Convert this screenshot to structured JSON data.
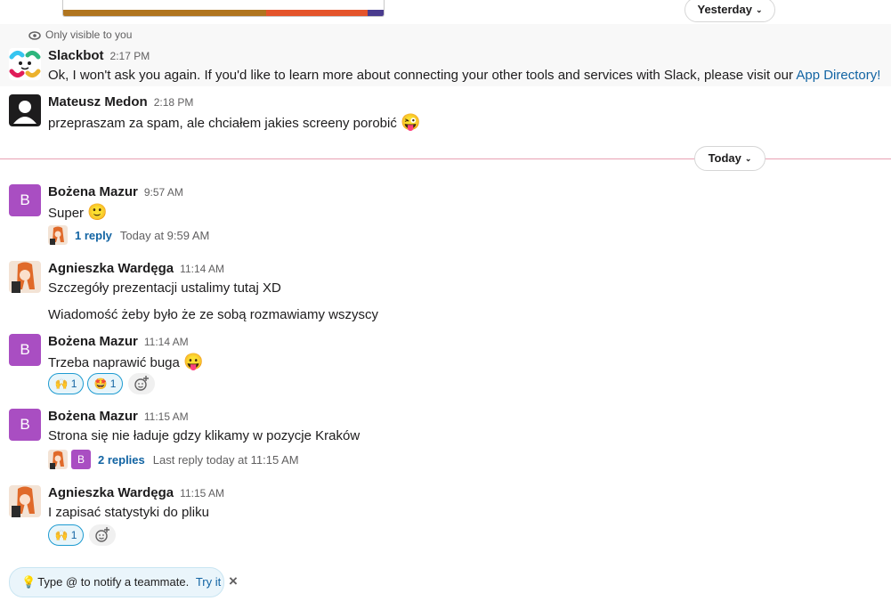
{
  "dividers": {
    "yesterday": "Yesterday",
    "today": "Today"
  },
  "ephemeral": {
    "note": "Only visible to you"
  },
  "messages": {
    "slackbot": {
      "author": "Slackbot",
      "time": "2:17 PM",
      "text": "Ok, I won't ask you again. If you'd like to learn more about connecting your other tools and services with Slack, please visit our ",
      "link": "App Directory!"
    },
    "m1": {
      "author": "Mateusz Medon",
      "time": "2:18 PM",
      "text": "przepraszam za spam, ale chciałem jakies screeny porobić"
    },
    "m2": {
      "author": "Bożena Mazur",
      "avatar_letter": "B",
      "time": "9:57 AM",
      "text": "Super",
      "reply_count": "1 reply",
      "reply_meta": "Today at 9:59 AM"
    },
    "m3": {
      "author": "Agnieszka Wardęga",
      "time": "11:14 AM",
      "text": "Szczegóły prezentacji ustalimy tutaj XD",
      "text2": "Wiadomość żeby było że ze sobą rozmawiamy wszyscy"
    },
    "m4": {
      "author": "Bożena Mazur",
      "avatar_letter": "B",
      "time": "11:14 AM",
      "text": "Trzeba naprawić buga",
      "reactions": [
        {
          "emoji": "🙌",
          "count": "1"
        },
        {
          "emoji": "🤩",
          "count": "1"
        }
      ]
    },
    "m5": {
      "author": "Bożena Mazur",
      "avatar_letter": "B",
      "time": "11:15 AM",
      "text": "Strona się nie ładuje gdzy klikamy w pozycje Kraków",
      "reply_count": "2 replies",
      "reply_meta": "Last reply today at 11:15 AM"
    },
    "m6": {
      "author": "Agnieszka Wardęga",
      "time": "11:15 AM",
      "text": "I zapisać statystyki do pliku",
      "reactions": [
        {
          "emoji": "🙌",
          "count": "1"
        }
      ]
    }
  },
  "hint": {
    "text": "Type @ to notify a teammate.",
    "action": "Try it",
    "close": "×"
  },
  "colors": {
    "link": "#1264a3",
    "avatar_b": "#a94ec2",
    "divider": "#e8a1b3",
    "reaction_bg": "#e8f5fa",
    "reaction_border": "#1d9bd1"
  }
}
